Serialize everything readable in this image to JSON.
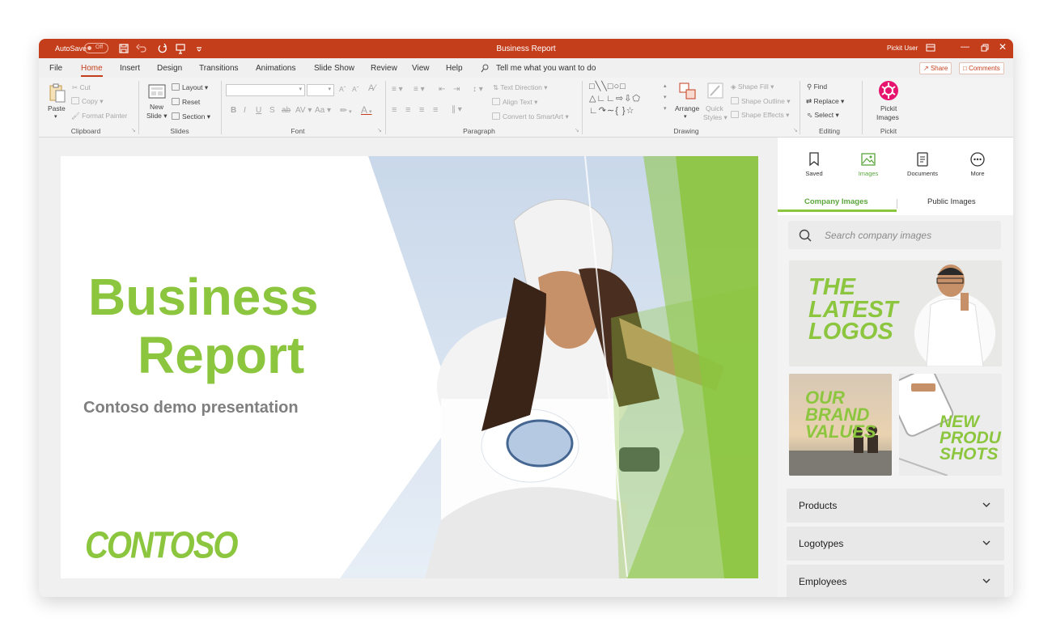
{
  "app": {
    "autosave_label": "AutoSave",
    "autosave_state": "Off",
    "document_title": "Business Report",
    "user_name": "Pickit User",
    "accent": "#c43e1c"
  },
  "tabs": [
    "File",
    "Home",
    "Insert",
    "Design",
    "Transitions",
    "Animations",
    "Slide Show",
    "Review",
    "View",
    "Help"
  ],
  "active_tab": "Home",
  "tell_me": "Tell me what you want to do",
  "share_label": "Share",
  "comments_label": "Comments",
  "ribbon": {
    "clipboard": {
      "label": "Clipboard",
      "paste": "Paste",
      "cut": "Cut",
      "copy": "Copy",
      "format_painter": "Format Painter"
    },
    "slides": {
      "label": "Slides",
      "new_slide_1": "New",
      "new_slide_2": "Slide",
      "layout": "Layout",
      "reset": "Reset",
      "section": "Section"
    },
    "font": {
      "label": "Font"
    },
    "paragraph": {
      "label": "Paragraph",
      "text_direction": "Text Direction",
      "align_text": "Align Text",
      "convert_smartart": "Convert to SmartArt"
    },
    "drawing": {
      "label": "Drawing",
      "arrange": "Arrange",
      "quick_styles_1": "Quick",
      "quick_styles_2": "Styles",
      "shape_fill": "Shape Fill",
      "shape_outline": "Shape Outline",
      "shape_effects": "Shape Effects"
    },
    "editing": {
      "label": "Editing",
      "find": "Find",
      "replace": "Replace",
      "select": "Select"
    },
    "pickit": {
      "label": "Pickit",
      "button_1": "Pickit",
      "button_2": "Images"
    }
  },
  "slide": {
    "title_line1": "Business",
    "title_line2": "Report",
    "subtitle": "Contoso demo presentation",
    "logo": "CONTOSO",
    "accent": "#8cc63f"
  },
  "pane": {
    "nav": [
      {
        "label": "Saved",
        "icon": "bookmark-icon"
      },
      {
        "label": "Images",
        "icon": "image-icon"
      },
      {
        "label": "Documents",
        "icon": "document-icon"
      },
      {
        "label": "More",
        "icon": "more-icon"
      }
    ],
    "image_tabs": [
      "Company Images",
      "Public Images"
    ],
    "search_placeholder": "Search company images",
    "thumbnails": [
      {
        "text_1": "THE",
        "text_2": "LATEST",
        "text_3": "LOGOS"
      },
      {
        "text_1": "OUR",
        "text_2": "BRAND",
        "text_3": "VALUES"
      },
      {
        "text_1": "NEW",
        "text_2": "PRODUCT",
        "text_3": "SHOTS"
      }
    ],
    "categories": [
      "Products",
      "Logotypes",
      "Employees"
    ]
  }
}
